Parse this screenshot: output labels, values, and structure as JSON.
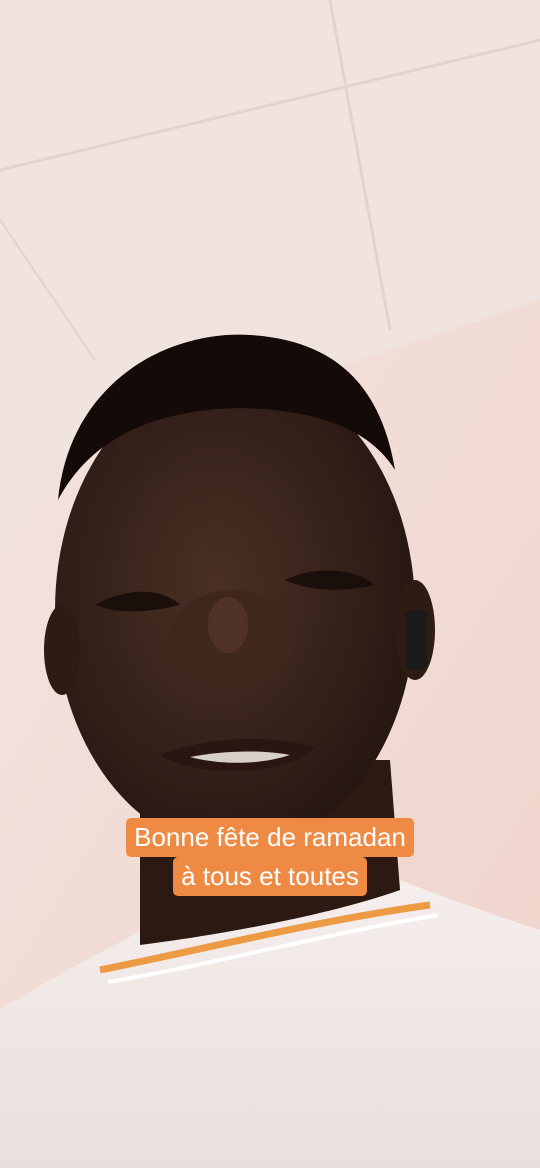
{
  "caption": {
    "line1": "Bonne fête de ramadan",
    "line2": "à tous et toutes",
    "background_color": "#ee8a43",
    "text_color": "#ffffff"
  }
}
